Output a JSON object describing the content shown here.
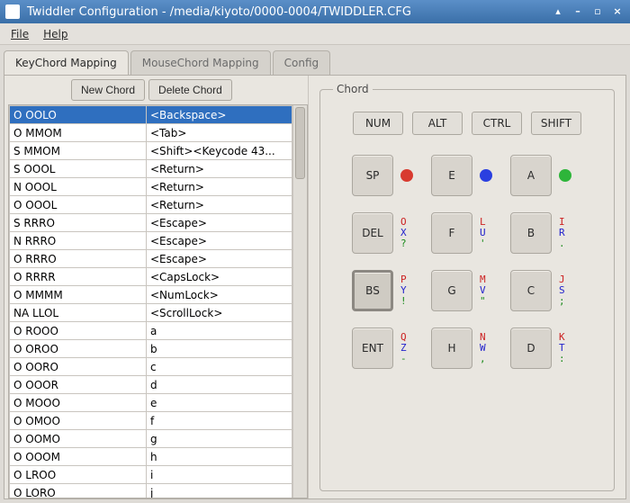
{
  "title": "Twiddler Configuration - /media/kiyoto/0000-0004/TWIDDLER.CFG",
  "menu": {
    "file": "File",
    "help": "Help"
  },
  "tabs": {
    "keychord": "KeyChord Mapping",
    "mousechord": "MouseChord Mapping",
    "config": "Config"
  },
  "buttons": {
    "new_chord": "New Chord",
    "delete_chord": "Delete Chord"
  },
  "chord_fieldset": "Chord",
  "mods": {
    "num": "NUM",
    "alt": "ALT",
    "ctrl": "CTRL",
    "shift": "SHIFT"
  },
  "keys": {
    "sp": "SP",
    "e": "E",
    "a": "A",
    "del": "DEL",
    "f": "F",
    "b": "B",
    "bs": "BS",
    "g": "G",
    "c": "C",
    "ent": "ENT",
    "h": "H",
    "d": "D"
  },
  "ann": {
    "r2c1": {
      "r": "O",
      "b": "X",
      "g": "?"
    },
    "r2c2": {
      "r": "L",
      "b": "U",
      "g": "'"
    },
    "r2c3": {
      "r": "I",
      "b": "R",
      "g": "."
    },
    "r3c1": {
      "r": "P",
      "b": "Y",
      "g": "!"
    },
    "r3c2": {
      "r": "M",
      "b": "V",
      "g": "\""
    },
    "r3c3": {
      "r": "J",
      "b": "S",
      "g": ";"
    },
    "r4c1": {
      "r": "Q",
      "b": "Z",
      "g": "-"
    },
    "r4c2": {
      "r": "N",
      "b": "W",
      "g": ","
    },
    "r4c3": {
      "r": "K",
      "b": "T",
      "g": ":"
    }
  },
  "rows": [
    {
      "chord": "O  OOLO",
      "out": "<Backspace>",
      "sel": true
    },
    {
      "chord": "O  MMOM",
      "out": "<Tab>"
    },
    {
      "chord": "S  MMOM",
      "out": "<Shift><Keycode 43..."
    },
    {
      "chord": "S  OOOL",
      "out": "<Return>"
    },
    {
      "chord": "N  OOOL",
      "out": "<Return>"
    },
    {
      "chord": "O  OOOL",
      "out": "<Return>"
    },
    {
      "chord": "S  RRRO",
      "out": "<Escape>"
    },
    {
      "chord": "N  RRRO",
      "out": "<Escape>"
    },
    {
      "chord": "O  RRRO",
      "out": "<Escape>"
    },
    {
      "chord": "O  RRRR",
      "out": "<CapsLock>"
    },
    {
      "chord": "O  MMMM",
      "out": "<NumLock>"
    },
    {
      "chord": "NA  LLOL",
      "out": "<ScrollLock>"
    },
    {
      "chord": "O  ROOO",
      "out": "a"
    },
    {
      "chord": "O  OROO",
      "out": "b"
    },
    {
      "chord": "O  OORO",
      "out": "c"
    },
    {
      "chord": "O  OOOR",
      "out": "d"
    },
    {
      "chord": "O  MOOO",
      "out": "e"
    },
    {
      "chord": "O  OMOO",
      "out": "f"
    },
    {
      "chord": "O  OOMO",
      "out": "g"
    },
    {
      "chord": "O  OOOM",
      "out": "h"
    },
    {
      "chord": "O  LROO",
      "out": "i"
    },
    {
      "chord": "O  LORO",
      "out": "j"
    }
  ]
}
